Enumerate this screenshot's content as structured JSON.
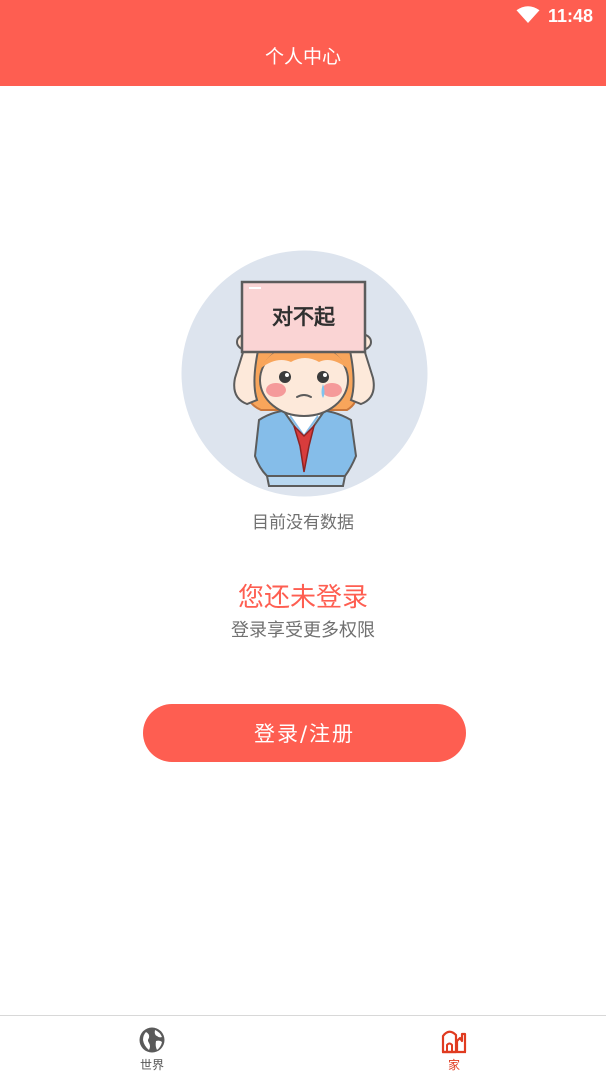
{
  "status_bar": {
    "time": "11:48",
    "wifi_icon": "wifi-icon",
    "color": "#ffffff"
  },
  "header": {
    "title": "个人中心",
    "background": "#fe5e51"
  },
  "empty_state": {
    "illustration": {
      "icon": "sorry-girl-illustration",
      "sign_text": "对不起"
    },
    "message": "目前没有数据"
  },
  "login_prompt": {
    "title": "您还未登录",
    "subtitle": "登录享受更多权限",
    "button_label": "登录/注册",
    "accent_color": "#fe5e51"
  },
  "tabbar": {
    "items": [
      {
        "label": "世界",
        "icon": "globe-icon",
        "active": false
      },
      {
        "label": "家",
        "icon": "home-icon",
        "active": true
      }
    ],
    "active_color": "#e03b20"
  }
}
